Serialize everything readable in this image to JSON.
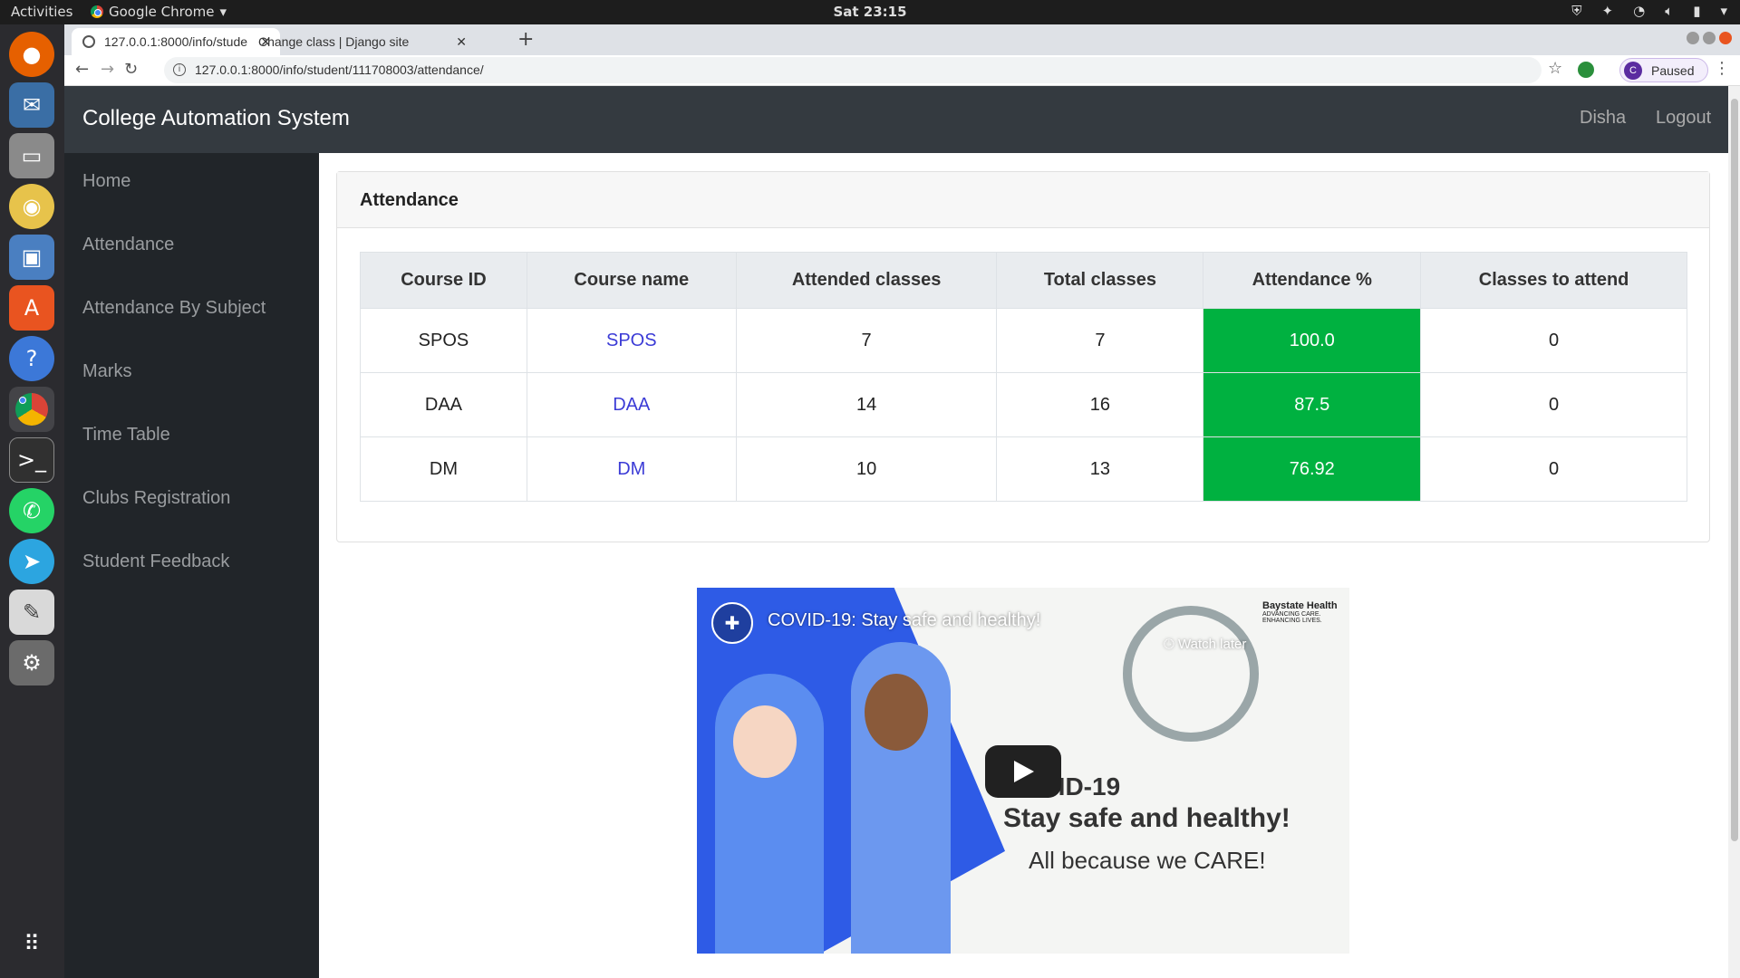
{
  "system_bar": {
    "activities": "Activities",
    "app_name": "Google Chrome",
    "clock": "Sat 23:15"
  },
  "browser": {
    "tabs": [
      {
        "title": "127.0.0.1:8000/info/stude"
      },
      {
        "title": "Change class | Django site"
      }
    ],
    "url": "127.0.0.1:8000/info/student/111708003/attendance/",
    "profile_initial": "C",
    "profile_status": "Paused"
  },
  "app": {
    "brand": "College Automation System",
    "user": "Disha",
    "logout": "Logout",
    "sidebar": [
      {
        "label": "Home"
      },
      {
        "label": "Attendance"
      },
      {
        "label": "Attendance By Subject"
      },
      {
        "label": "Marks"
      },
      {
        "label": "Time Table"
      },
      {
        "label": "Clubs Registration"
      },
      {
        "label": "Student Feedback"
      }
    ]
  },
  "attendance": {
    "title": "Attendance",
    "headers": [
      "Course ID",
      "Course name",
      "Attended classes",
      "Total classes",
      "Attendance %",
      "Classes to attend"
    ],
    "rows": [
      {
        "id": "SPOS",
        "name": "SPOS",
        "attended": "7",
        "total": "7",
        "percent": "100.0",
        "to_attend": "0"
      },
      {
        "id": "DAA",
        "name": "DAA",
        "attended": "14",
        "total": "16",
        "percent": "87.5",
        "to_attend": "0"
      },
      {
        "id": "DM",
        "name": "DM",
        "attended": "10",
        "total": "13",
        "percent": "76.92",
        "to_attend": "0"
      }
    ],
    "good_color": "#00b140"
  },
  "video": {
    "title": "COVID-19: Stay safe and healthy!",
    "watch_later": "Watch later",
    "line1": "COVID-19",
    "line2": "Stay safe and healthy!",
    "line3": "All because we CARE!",
    "logo_name": "Baystate Health",
    "logo_tagline": "ADVANCING CARE. ENHANCING LIVES."
  }
}
